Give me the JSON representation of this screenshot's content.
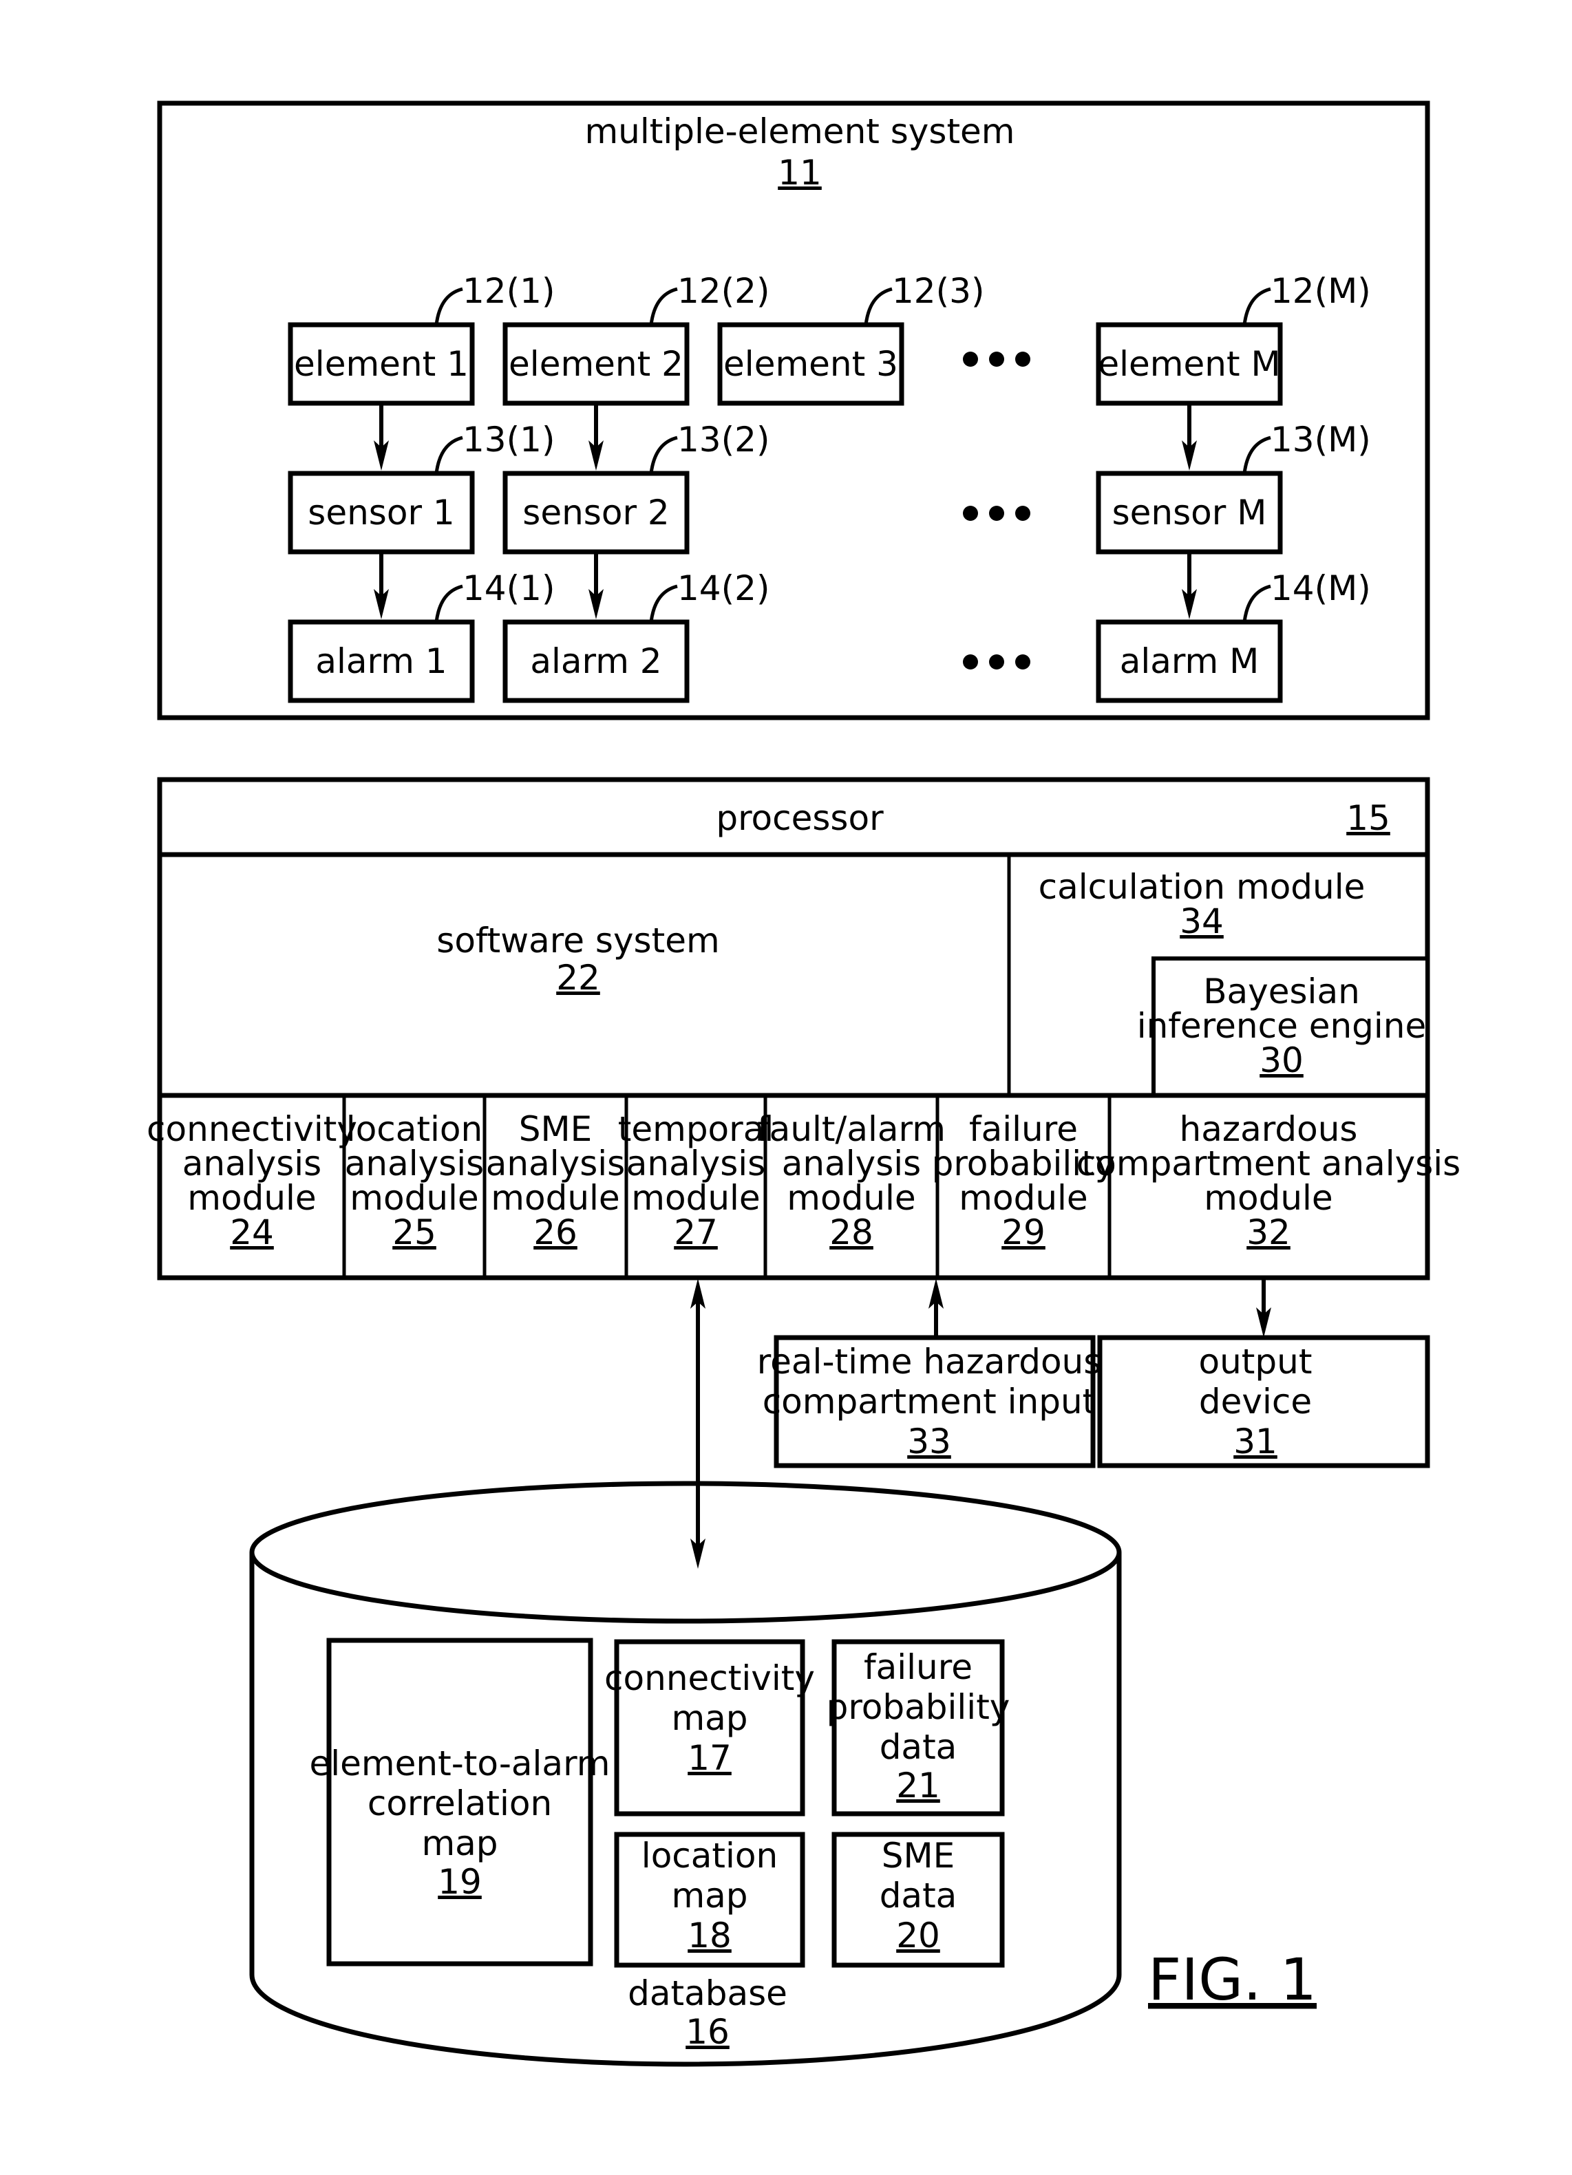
{
  "figure_label": "FIG. 1",
  "system": {
    "title": "multiple-element system",
    "ref": "11",
    "ellipsis": "•••",
    "elements": [
      {
        "label": "element 1",
        "ref": "12(1)"
      },
      {
        "label": "element 2",
        "ref": "12(2)"
      },
      {
        "label": "element 3",
        "ref": "12(3)"
      },
      {
        "label": "element M",
        "ref": "12(M)"
      }
    ],
    "sensors": [
      {
        "label": "sensor 1",
        "ref": "13(1)"
      },
      {
        "label": "sensor 2",
        "ref": "13(2)"
      },
      {
        "label": "sensor M",
        "ref": "13(M)"
      }
    ],
    "alarms": [
      {
        "label": "alarm 1",
        "ref": "14(1)"
      },
      {
        "label": "alarm 2",
        "ref": "14(2)"
      },
      {
        "label": "alarm M",
        "ref": "14(M)"
      }
    ]
  },
  "processor": {
    "title": "processor",
    "ref": "15",
    "software_system": {
      "label": "software system",
      "ref": "22"
    },
    "calculation_module": {
      "label": "calculation module",
      "ref": "34"
    },
    "bayesian_engine": {
      "lines": [
        "Bayesian",
        "inference engine"
      ],
      "ref": "30"
    },
    "modules": [
      {
        "lines": [
          "connectivity",
          "analysis",
          "module"
        ],
        "ref": "24"
      },
      {
        "lines": [
          "location",
          "analysis",
          "module"
        ],
        "ref": "25"
      },
      {
        "lines": [
          "SME",
          "analysis",
          "module"
        ],
        "ref": "26"
      },
      {
        "lines": [
          "temporal",
          "analysis",
          "module"
        ],
        "ref": "27"
      },
      {
        "lines": [
          "fault/alarm",
          "analysis",
          "module"
        ],
        "ref": "28"
      },
      {
        "lines": [
          "failure",
          "probability",
          "module"
        ],
        "ref": "29"
      },
      {
        "lines": [
          "hazardous",
          "compartment analysis",
          "module"
        ],
        "ref": "32"
      }
    ]
  },
  "realtime_input": {
    "lines": [
      "real-time hazardous",
      "compartment input"
    ],
    "ref": "33"
  },
  "output_device": {
    "lines": [
      "output",
      "device"
    ],
    "ref": "31"
  },
  "database": {
    "label": "database",
    "ref": "16",
    "items": [
      {
        "lines": [
          "element-to-alarm",
          "correlation",
          "map"
        ],
        "ref": "19"
      },
      {
        "lines": [
          "connectivity",
          "map"
        ],
        "ref": "17"
      },
      {
        "lines": [
          "failure",
          "probability",
          "data"
        ],
        "ref": "21"
      },
      {
        "lines": [
          "location",
          "map"
        ],
        "ref": "18"
      },
      {
        "lines": [
          "SME",
          "data"
        ],
        "ref": "20"
      }
    ]
  }
}
